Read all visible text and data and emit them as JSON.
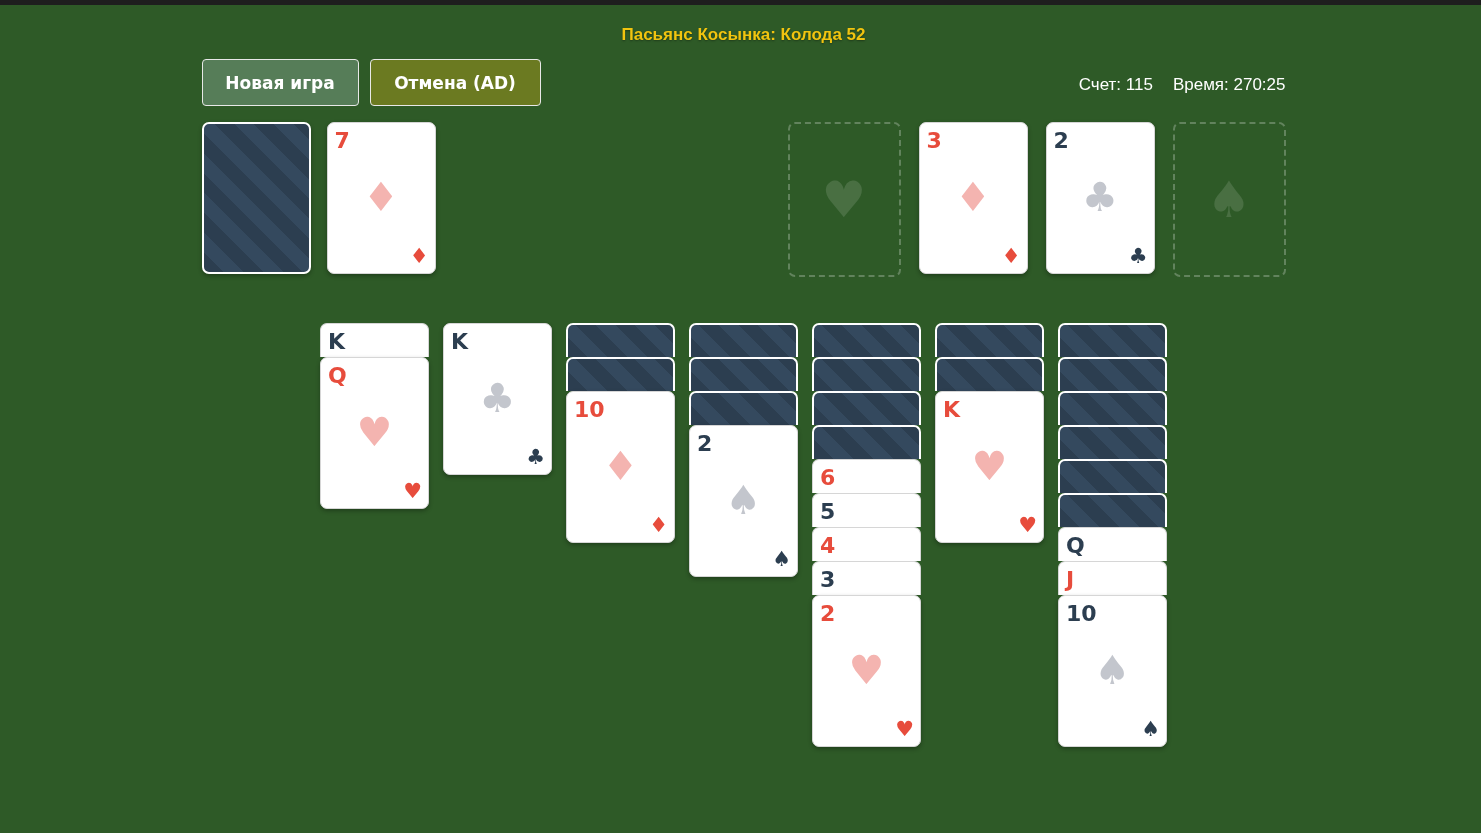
{
  "title": "Пасьянс Косынка: Колода 52",
  "buttons": [
    {
      "label": "Новая игра",
      "kind": "new"
    },
    {
      "label": "Отмена (AD)",
      "kind": "undo"
    }
  ],
  "stats": [
    "Счет: 115",
    "Время: 270:25"
  ],
  "stock": {
    "kind": "back"
  },
  "waste": {
    "kind": "face",
    "rank": "7",
    "red": true,
    "pip": "♦",
    "corner_pip": "♦"
  },
  "foundations": [
    {
      "kind": "empty",
      "pip": "♥"
    },
    {
      "kind": "face",
      "rank": "3",
      "red": true,
      "pip": "♦",
      "corner_pip": "♦"
    },
    {
      "kind": "face",
      "rank": "2",
      "red": false,
      "pip": "♣",
      "corner_pip": "♣"
    },
    {
      "kind": "empty",
      "pip": "♠"
    }
  ],
  "tableau": [
    [
      {
        "kind": "face",
        "rank": "K",
        "red": false
      },
      {
        "kind": "face",
        "rank": "Q",
        "red": true,
        "pip": "♥",
        "corner_pip": "♥"
      }
    ],
    [
      {
        "kind": "face",
        "rank": "K",
        "red": false,
        "pip": "♣",
        "corner_pip": "♣"
      }
    ],
    [
      {
        "kind": "back"
      },
      {
        "kind": "back"
      },
      {
        "kind": "face",
        "rank": "10",
        "red": true,
        "pip": "♦",
        "corner_pip": "♦"
      }
    ],
    [
      {
        "kind": "back"
      },
      {
        "kind": "back"
      },
      {
        "kind": "back"
      },
      {
        "kind": "face",
        "rank": "2",
        "red": false,
        "pip": "♠",
        "corner_pip": "♠"
      }
    ],
    [
      {
        "kind": "back"
      },
      {
        "kind": "back"
      },
      {
        "kind": "back"
      },
      {
        "kind": "back"
      },
      {
        "kind": "face",
        "rank": "6",
        "red": true
      },
      {
        "kind": "face",
        "rank": "5",
        "red": false
      },
      {
        "kind": "face",
        "rank": "4",
        "red": true
      },
      {
        "kind": "face",
        "rank": "3",
        "red": false
      },
      {
        "kind": "face",
        "rank": "2",
        "red": true,
        "pip": "♥",
        "corner_pip": "♥"
      }
    ],
    [
      {
        "kind": "back"
      },
      {
        "kind": "back"
      },
      {
        "kind": "face",
        "rank": "K",
        "red": true,
        "pip": "♥",
        "corner_pip": "♥"
      }
    ],
    [
      {
        "kind": "back"
      },
      {
        "kind": "back"
      },
      {
        "kind": "back"
      },
      {
        "kind": "back"
      },
      {
        "kind": "back"
      },
      {
        "kind": "back"
      },
      {
        "kind": "face",
        "rank": "Q",
        "red": false
      },
      {
        "kind": "face",
        "rank": "J",
        "red": true
      },
      {
        "kind": "face",
        "rank": "10",
        "red": false,
        "pip": "♠",
        "corner_pip": "♠"
      }
    ]
  ]
}
